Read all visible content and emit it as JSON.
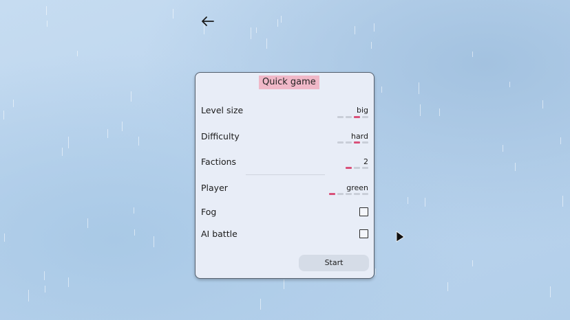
{
  "panel": {
    "title": "Quick game",
    "settings": [
      {
        "label": "Level size",
        "value": "big",
        "options_count": 4,
        "selected_index": 2
      },
      {
        "label": "Difficulty",
        "value": "hard",
        "options_count": 4,
        "selected_index": 2
      },
      {
        "label": "Factions",
        "value": "2",
        "options_count": 3,
        "selected_index": 0
      },
      {
        "label": "Player",
        "value": "green",
        "options_count": 5,
        "selected_index": 0
      }
    ],
    "toggles": [
      {
        "label": "Fog",
        "checked": false
      },
      {
        "label": "AI battle",
        "checked": false
      }
    ],
    "start_label": "Start"
  },
  "icons": {
    "back": "back-arrow-icon",
    "cursor": "mouse-pointer-icon"
  },
  "colors": {
    "accent": "#d9517a",
    "title_bg": "#f0b8c8",
    "panel_bg": "#e8edf7",
    "button_bg": "#d5dce7"
  }
}
